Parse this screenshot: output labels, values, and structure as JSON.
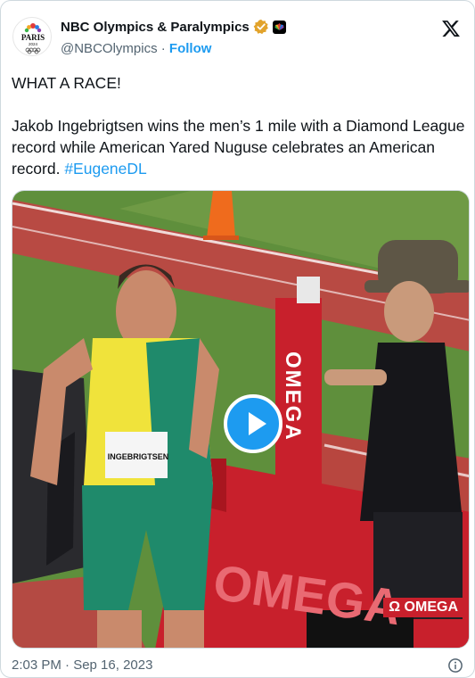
{
  "account": {
    "name": "NBC Olympics & Paralympics",
    "handle": "@NBCOlympics",
    "separator": "·",
    "follow_label": "Follow",
    "avatar_text": "PARIS",
    "avatar_sub": "2024"
  },
  "tweet": {
    "line1": "WHAT A RACE!",
    "body": "Jakob Ingebrigtsen wins the men’s 1 mile with a Diamond League record while American Yared Nuguse celebrates an American record. ",
    "hashtag": "#EugeneDL"
  },
  "media": {
    "bib_name": "INGEBRIGTSEN",
    "sponsor_vertical": "OMEGA",
    "sponsor_board": "OMEGA",
    "sponsor_corner": "Ω OMEGA",
    "play_icon": "play-icon"
  },
  "footer": {
    "timestamp": "2:03 PM · Sep 16, 2023"
  },
  "colors": {
    "accent": "#1d9bf0",
    "verified": "#e2a32b",
    "track": "#b84540",
    "grass": "#5a8a3a",
    "omega_red": "#c8202c"
  }
}
